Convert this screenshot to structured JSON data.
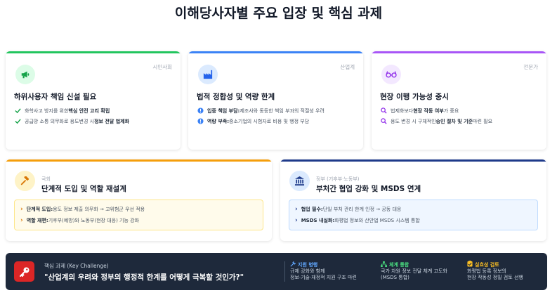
{
  "page": {
    "title": "이해당사자별 주요 입장 및 핵심 과제"
  },
  "colors": {
    "green": "#22c55e",
    "blue": "#3b82f6",
    "purple": "#a855f7",
    "orange": "#f59e0b",
    "navy": "#1e3a8a",
    "red": "#dc2626",
    "footer_bg": "#1e293b"
  },
  "cards_top": [
    {
      "tag": "시민사회",
      "icon": "megaphone-icon",
      "title": "하위사용자 책임 신설 필요",
      "items": [
        {
          "pre": "화학사고 방지를 위한 ",
          "bold": "핵심 안전 고리 확립",
          "post": ""
        },
        {
          "pre": "공급망 소통 의무화로 용도변경 시 ",
          "bold": "정보 전달 법제화",
          "post": ""
        }
      ]
    },
    {
      "tag": "산업계",
      "icon": "factory-icon",
      "title": "법적 정합성 및 역량 한계",
      "items": [
        {
          "pre": "",
          "bold": "입증 책임 부담:",
          "post": " 제조사와 동등한 책임 부과의 적절성 우려"
        },
        {
          "pre": "",
          "bold": "역량 부족:",
          "post": " 중소기업의 시험자료 비용 및 행정 부담"
        }
      ]
    },
    {
      "tag": "전문가",
      "icon": "glasses-icon",
      "title": "현장 이행 가능성 중시",
      "items": [
        {
          "pre": "법제화보다 ",
          "bold": "현장 작동 여부",
          "post": "가 중요"
        },
        {
          "pre": "용도 변경 시 구체적인 ",
          "bold": "승인 절차 및 기준",
          "post": " 마련 필요"
        }
      ]
    }
  ],
  "cards_bottom": [
    {
      "tag": "국회",
      "icon": "gavel-icon",
      "title": "단계적 도입 및 역할 재설계",
      "items": [
        {
          "bold": "단계적 도입:",
          "post": " 용도 정보 제출 의무화 → 고위험군 우선 적용"
        },
        {
          "bold": "역할 재편:",
          "post": " 기후부(예방)와 노동부(현장 대응) 기능 강화"
        }
      ]
    },
    {
      "tag": "정부 (기후부·노동부)",
      "icon": "government-building-icon",
      "title": "부처간 협업 강화 및 MSDS 연계",
      "items": [
        {
          "bold": "협업 필수:",
          "post": " 단일 부처 관리 한계 인정 → 공동 대응"
        },
        {
          "bold": "MSDS 내실화:",
          "post": " 화평법 정보와 산안법 MSDS 시스템 통합"
        }
      ]
    }
  ],
  "footer": {
    "label": "핵심 과제 (Key Challenge)",
    "text": "\"산업계의 우려와 정부의 행정적 한계를 어떻게 극복할 것인가?\"",
    "cols": [
      {
        "icon": "tools-icon",
        "head": "지원 병행",
        "lines": [
          "규제 강화와 함께",
          "정보·기술·재정적 지원 구조 마련"
        ]
      },
      {
        "icon": "network-icon",
        "head": "체계 통합",
        "lines": [
          "국가 차원 정보 전달 체계 고도화",
          "(MSDS 통합)"
        ]
      },
      {
        "icon": "clipboard-check-icon",
        "head": "실효성 검토",
        "lines": [
          "화평법 등록 정보의",
          "현장 작동성 정밀 검토 선행"
        ]
      }
    ]
  }
}
